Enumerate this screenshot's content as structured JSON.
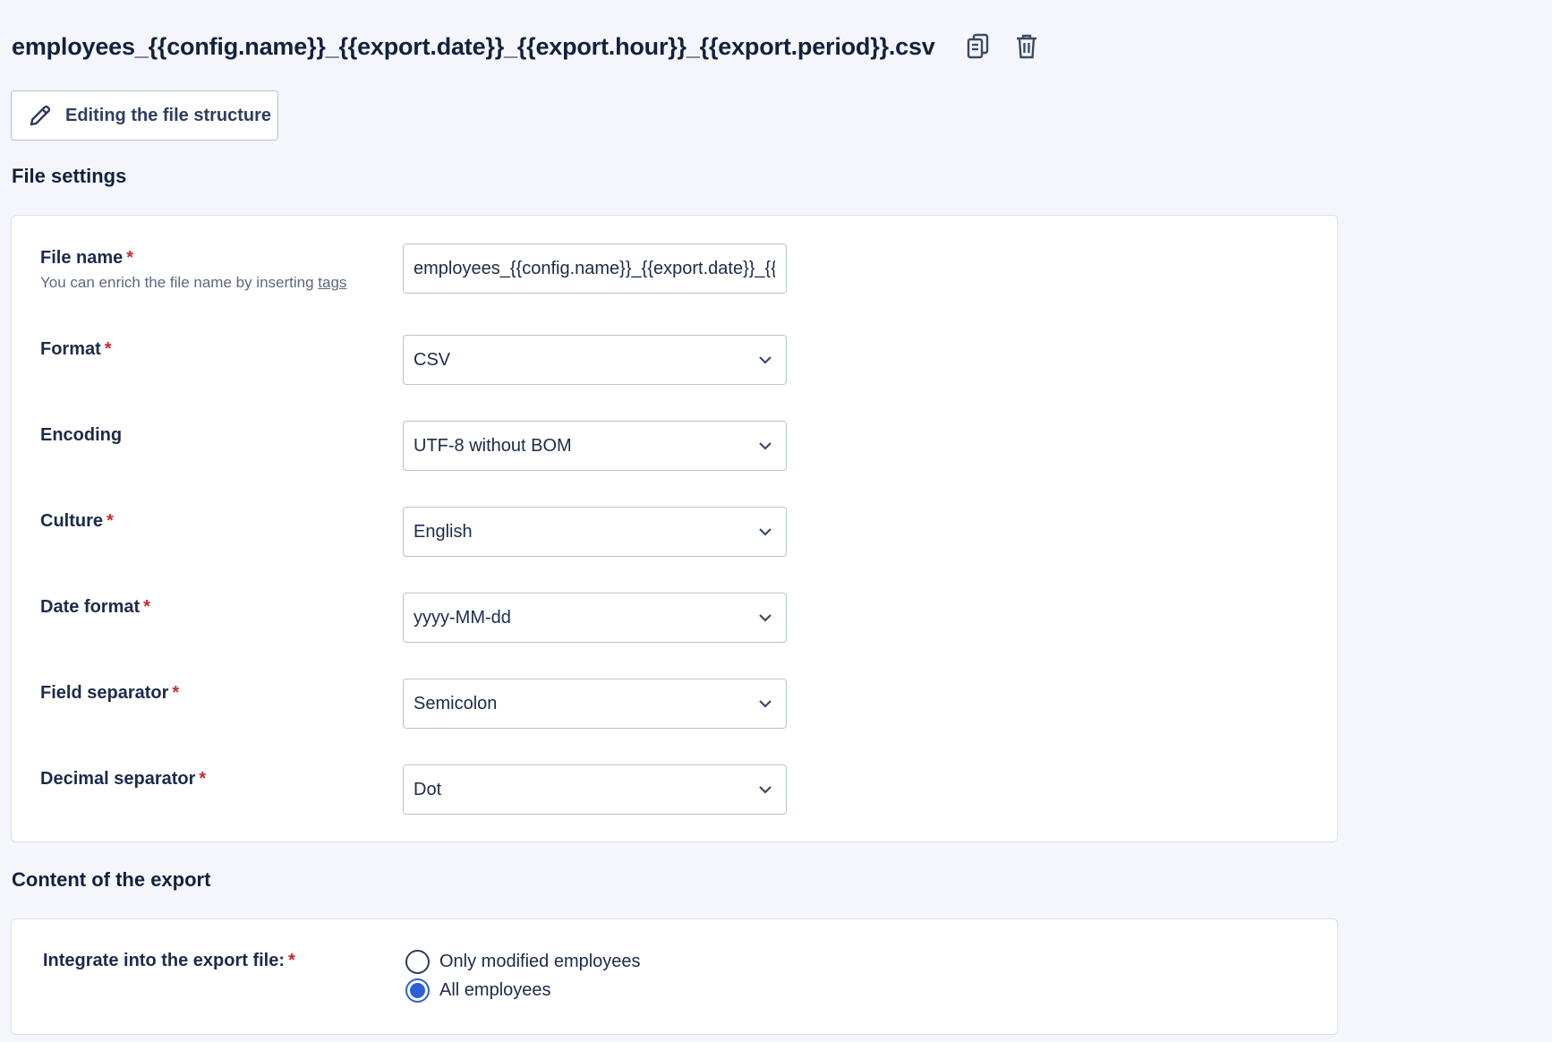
{
  "header": {
    "title": "employees_{{config.name}}_{{export.date}}_{{export.hour}}_{{export.period}}.csv",
    "copy_icon": "copy-icon",
    "delete_icon": "trash-icon"
  },
  "edit_structure": {
    "label": "Editing the file structure",
    "icon": "pencil-icon"
  },
  "file_settings": {
    "title": "File settings",
    "file_name": {
      "label": "File name",
      "required": "*",
      "hint_prefix": "You can enrich the file name by inserting ",
      "hint_link": "tags",
      "value": "employees_{{config.name}}_{{export.date}}_{{export.hour}}_{{export.period}}.csv"
    },
    "format": {
      "label": "Format",
      "required": "*",
      "value": "CSV"
    },
    "encoding": {
      "label": "Encoding",
      "value": "UTF-8 without BOM"
    },
    "culture": {
      "label": "Culture",
      "required": "*",
      "value": "English"
    },
    "date_format": {
      "label": "Date format",
      "required": "*",
      "value": "yyyy-MM-dd"
    },
    "field_separator": {
      "label": "Field separator",
      "required": "*",
      "value": "Semicolon"
    },
    "decimal_separator": {
      "label": "Decimal separator",
      "required": "*",
      "value": "Dot"
    }
  },
  "content": {
    "title": "Content of the export",
    "integrate": {
      "label": "Integrate into the export file:",
      "required": "*",
      "options": [
        {
          "label": "Only modified employees",
          "checked": false
        },
        {
          "label": "All employees",
          "checked": true
        }
      ]
    }
  },
  "colors": {
    "accent": "#2e5fd6",
    "required": "#c8282f",
    "background": "#f4f6fb"
  }
}
